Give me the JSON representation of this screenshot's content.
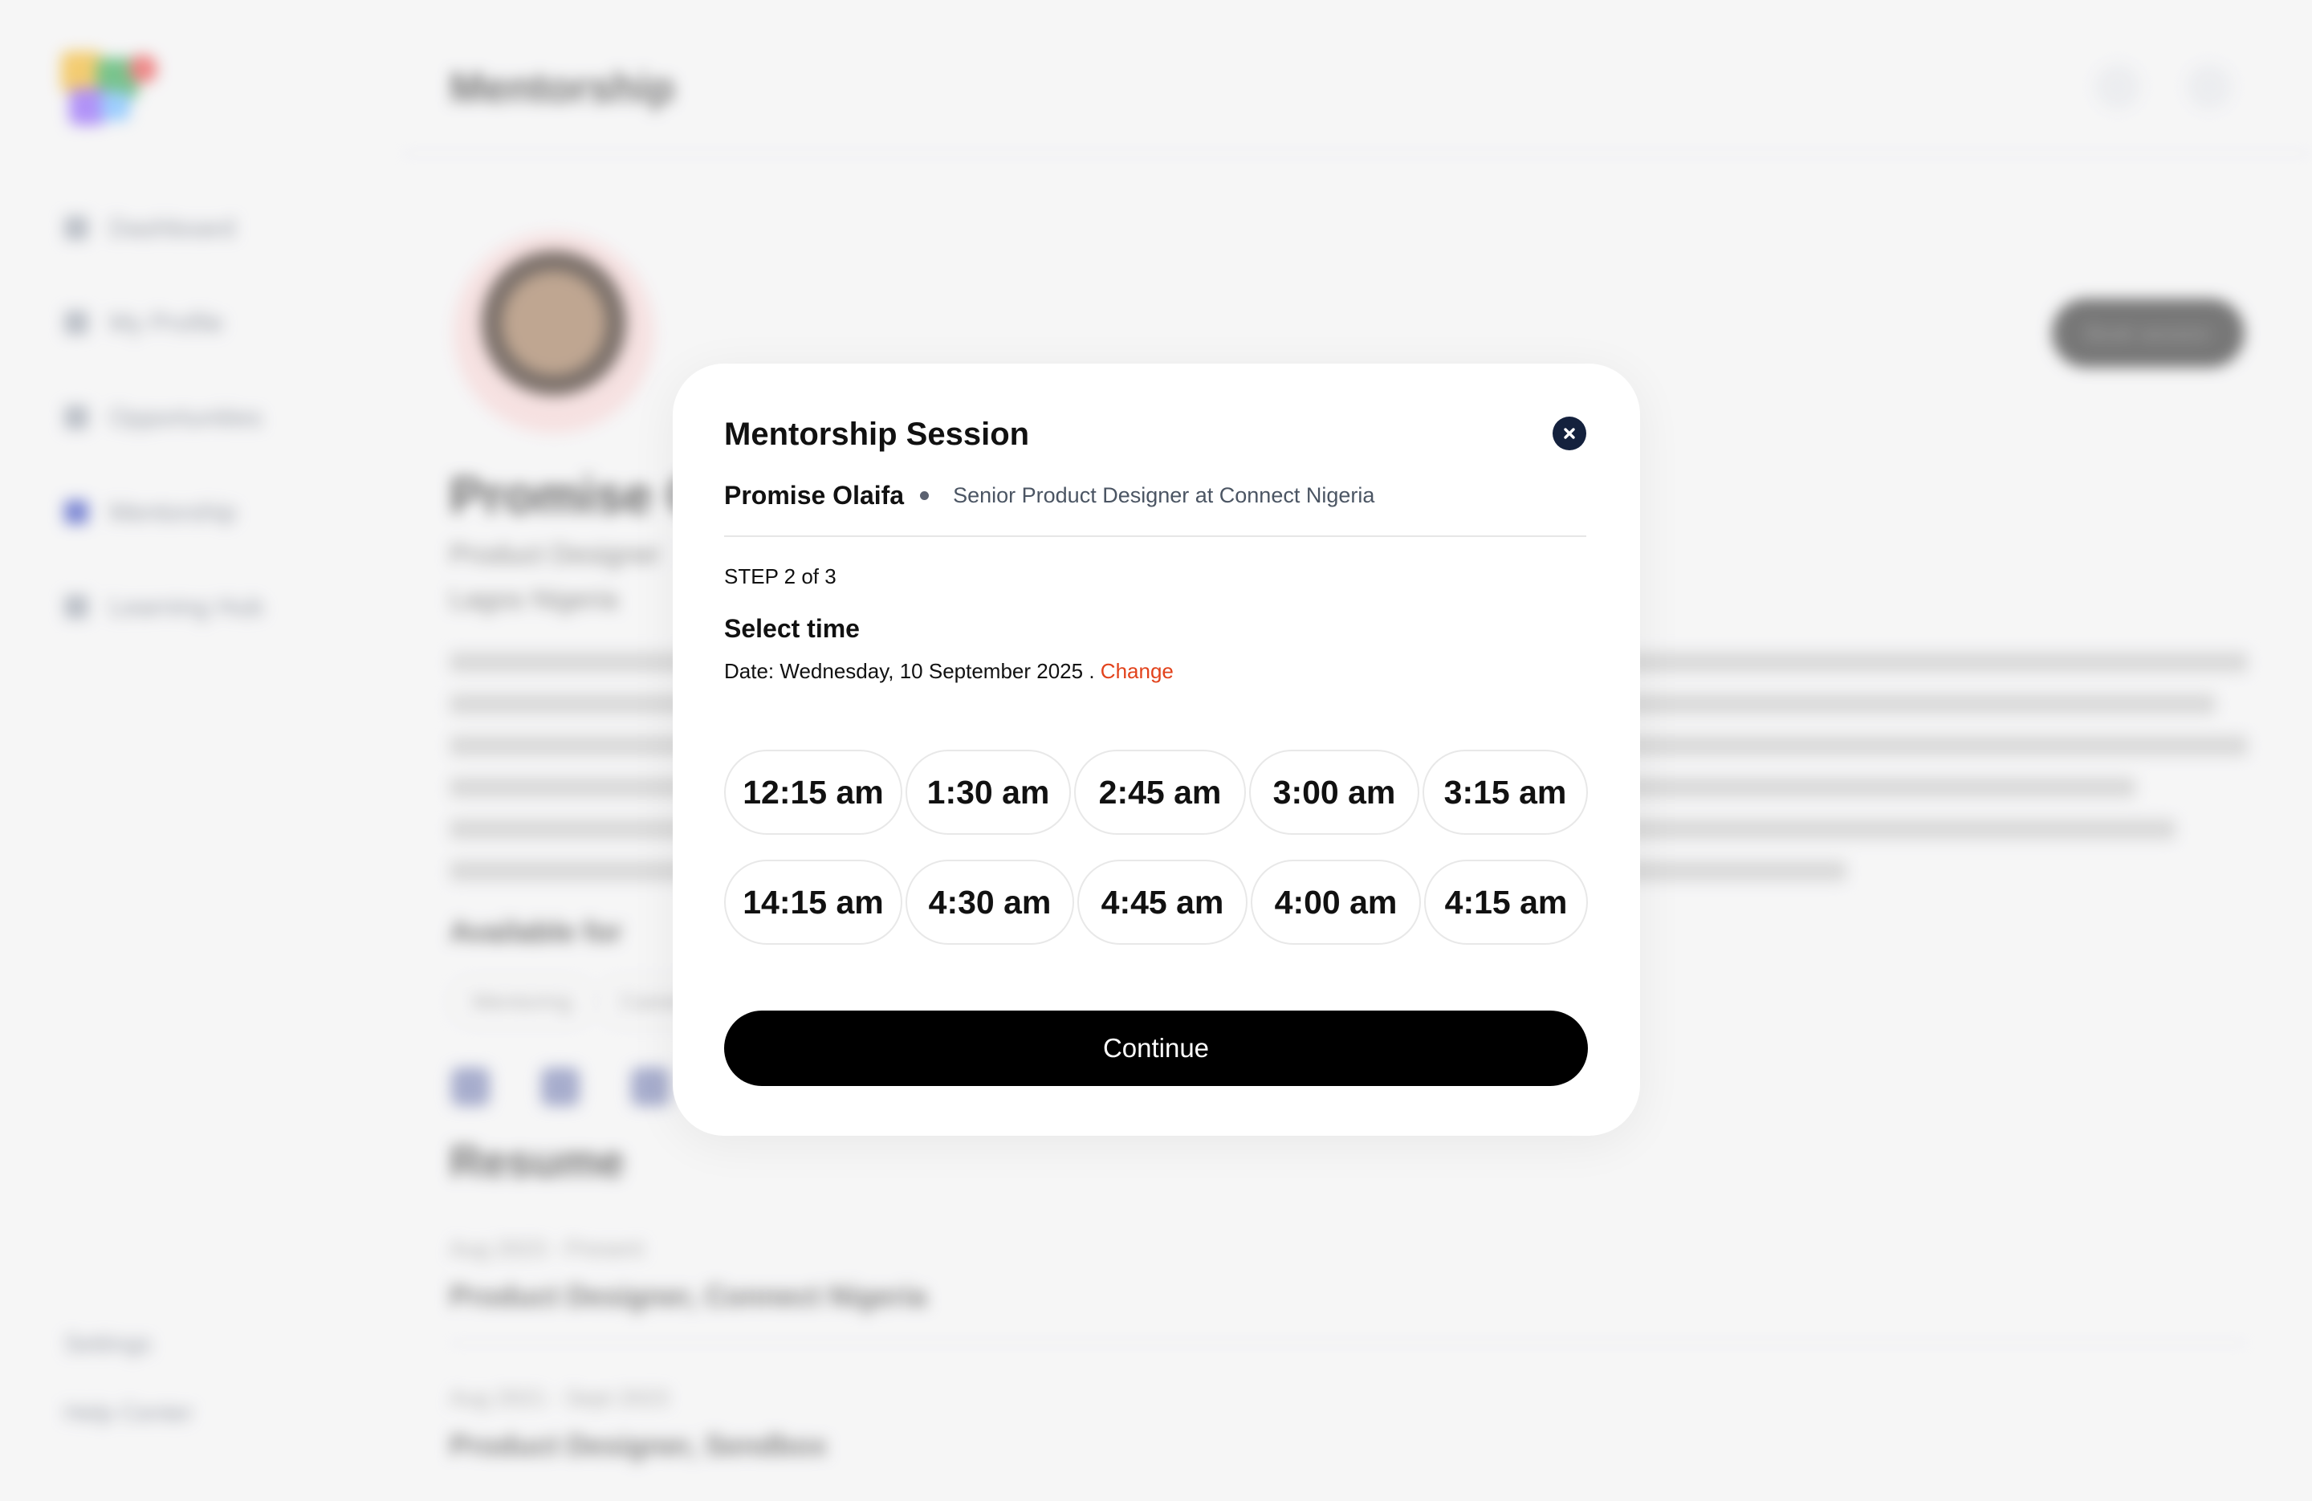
{
  "colors": {
    "accent": "#e2421b",
    "primary_button": "#000000",
    "close_button": "#14213d"
  },
  "background": {
    "page_title": "Mentorship",
    "sidebar": {
      "items": [
        {
          "label": "Dashboard",
          "icon": "grid-icon"
        },
        {
          "label": "My Profile",
          "icon": "user-icon"
        },
        {
          "label": "Opportunities",
          "icon": "briefcase-icon"
        },
        {
          "label": "Mentorship",
          "icon": "users-icon"
        },
        {
          "label": "Learning Hub",
          "icon": "book-icon"
        }
      ],
      "bottom": [
        "Settings",
        "Help Center"
      ]
    },
    "header_icons": [
      "bell-icon",
      "settings-icon"
    ],
    "profile": {
      "name": "Promise Olaifa",
      "title": "Product Designer",
      "location": "Lagos Nigeria",
      "action_label": "Book session"
    },
    "available_for": {
      "title": "Available for",
      "tags": [
        "Mentoring",
        "Career advice"
      ]
    },
    "social_icons": [
      "twitter-icon",
      "linkedin-icon",
      "dribbble-icon"
    ],
    "resume": {
      "title": "Resume",
      "entries": [
        {
          "meta": "Aug 2023 - Present",
          "role": "Product Designer, Connect Nigeria"
        },
        {
          "meta": "Aug 2021 - Sept 2023",
          "role": "Product Designer, Sendbox"
        }
      ]
    }
  },
  "modal": {
    "title": "Mentorship Session",
    "close_icon": "close-icon",
    "mentor_name": "Promise Olaifa",
    "mentor_role": "Senior Product Designer at Connect Nigeria",
    "step": "STEP 2 of 3",
    "section_title": "Select time",
    "date_text": "Date: Wednesday, 10 September 2025 .",
    "change_label": "Change",
    "time_slots": [
      [
        "12:15 am",
        "1:30 am",
        "2:45 am",
        "3:00 am",
        "3:15 am"
      ],
      [
        "14:15 am",
        "4:30 am",
        "4:45 am",
        "4:00 am",
        "4:15 am"
      ]
    ],
    "continue_label": "Continue"
  }
}
